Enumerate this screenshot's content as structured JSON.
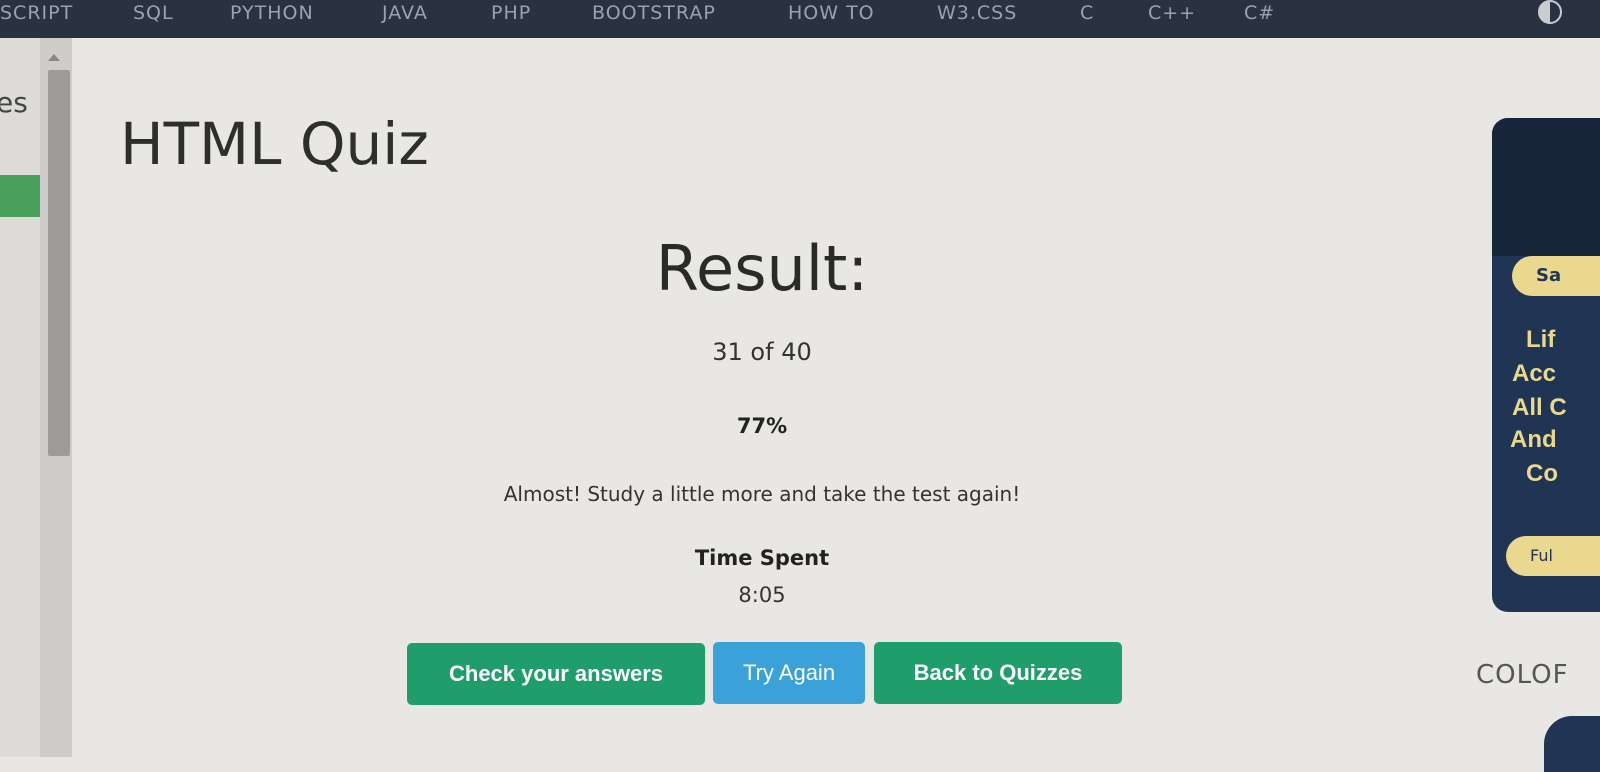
{
  "nav": {
    "items": [
      "SCRIPT",
      "SQL",
      "PYTHON",
      "JAVA",
      "PHP",
      "BOOTSTRAP",
      "HOW TO",
      "W3.CSS",
      "C",
      "C++",
      "C#"
    ]
  },
  "sidebar": {
    "partial_text": "es"
  },
  "main": {
    "title": "HTML Quiz",
    "result_heading": "Result:",
    "score": "31 of 40",
    "percent": "77%",
    "message": "Almost! Study a little more and take the test again!",
    "time_label": "Time Spent",
    "time_value": "8:05"
  },
  "buttons": {
    "check": "Check your answers",
    "try_again": "Try Again",
    "back": "Back to Quizzes"
  },
  "ad": {
    "pill": "Sa",
    "lines": [
      "Lif",
      "Acc",
      "All C",
      "And",
      "Co"
    ],
    "cta": "Ful"
  },
  "color_label": "COLOF",
  "colors": {
    "nav_bg": "#283241",
    "accent_green": "#1f9e6b",
    "accent_blue": "#3aa2d8",
    "ad_bg": "#1f3553",
    "ad_gold": "#e9d88e"
  }
}
